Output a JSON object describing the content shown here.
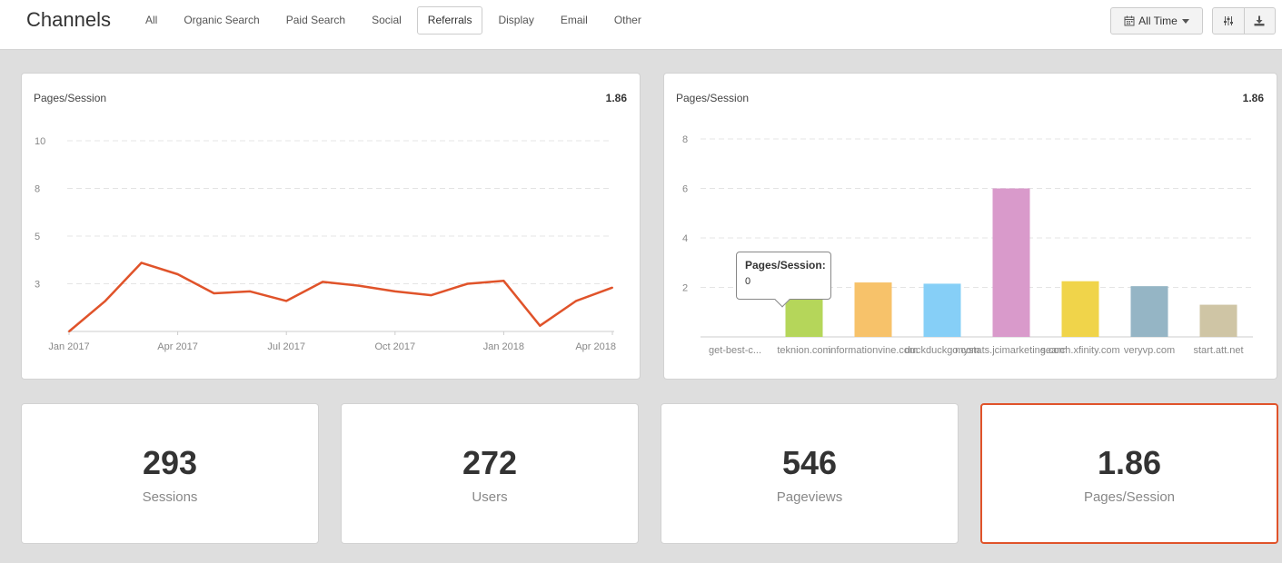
{
  "header": {
    "title": "Channels",
    "tabs": [
      {
        "label": "All"
      },
      {
        "label": "Organic Search"
      },
      {
        "label": "Paid Search"
      },
      {
        "label": "Social"
      },
      {
        "label": "Referrals",
        "active": true
      },
      {
        "label": "Display"
      },
      {
        "label": "Email"
      },
      {
        "label": "Other"
      }
    ],
    "time_button": {
      "label": "All Time",
      "icon": "calendar-icon",
      "caret": "caret-down-icon"
    },
    "settings_icon": "sliders-icon",
    "download_icon": "download-icon"
  },
  "line_card": {
    "title": "Pages/Session",
    "value": "1.86",
    "chart_data": {
      "type": "line",
      "color": "#e0532a",
      "x": [
        "Jan 2017",
        "Feb 2017",
        "Mar 2017",
        "Apr 2017",
        "May 2017",
        "Jun 2017",
        "Jul 2017",
        "Aug 2017",
        "Sep 2017",
        "Oct 2017",
        "Nov 2017",
        "Dec 2017",
        "Jan 2018",
        "Feb 2018",
        "Mar 2018",
        "Apr 2018"
      ],
      "y": [
        0,
        1.6,
        3.6,
        3.0,
        2.0,
        2.1,
        1.6,
        2.6,
        2.4,
        2.1,
        1.9,
        2.5,
        2.65,
        0.3,
        1.6,
        2.3
      ],
      "x_tick_labels": [
        "Jan 2017",
        "Apr 2017",
        "Jul 2017",
        "Oct 2017",
        "Jan 2018",
        "Apr 2018"
      ],
      "y_tick_labels": [
        "10",
        "8",
        "5",
        "3"
      ],
      "y_tick_values": [
        10,
        7.5,
        5,
        2.5
      ],
      "ylim": [
        0,
        10
      ],
      "grid": true
    }
  },
  "bar_card": {
    "title": "Pages/Session",
    "value": "1.86",
    "tooltip": {
      "title": "Pages/Session:",
      "value": "0"
    },
    "chart_data": {
      "type": "bar",
      "categories": [
        "get-best-c...",
        "teknion.com",
        "informationvine.com",
        "duckduckgo.com",
        "mystats.jcimarketing.com",
        "search.xfinity.com",
        "veryvp.com",
        "start.att.net"
      ],
      "values": [
        0,
        2.2,
        2.2,
        2.15,
        6.0,
        2.25,
        2.05,
        1.3
      ],
      "colors": [
        "#e0532a",
        "#b5d65a",
        "#f7c26a",
        "#86cff7",
        "#d99acb",
        "#f0d44a",
        "#95b5c5",
        "#cfc5a5"
      ],
      "y_tick_labels": [
        "8",
        "6",
        "4",
        "2"
      ],
      "y_tick_values": [
        8,
        6,
        4,
        2
      ],
      "ylim": [
        0,
        8
      ],
      "grid": true
    }
  },
  "stats": [
    {
      "value": "293",
      "label": "Sessions"
    },
    {
      "value": "272",
      "label": "Users"
    },
    {
      "value": "546",
      "label": "Pageviews"
    },
    {
      "value": "1.86",
      "label": "Pages/Session",
      "selected": true
    }
  ]
}
